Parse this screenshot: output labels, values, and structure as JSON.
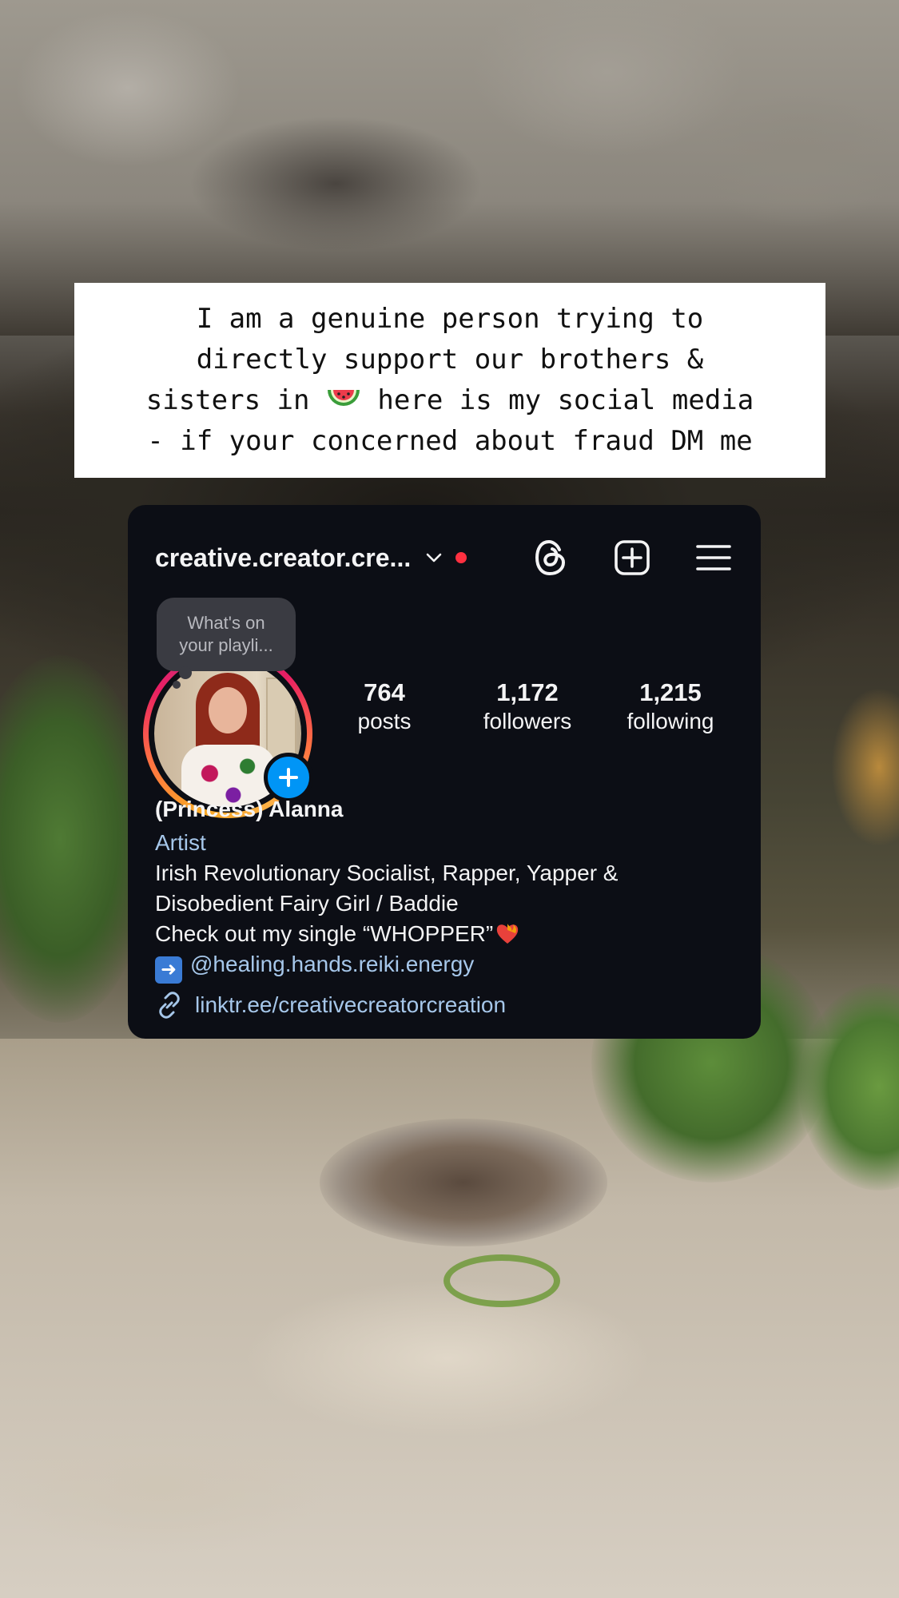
{
  "caption": {
    "line1": "I am a genuine person trying to",
    "line2": "directly support our brothers &",
    "line3_a": "sisters in ",
    "line3_b": " here is my social media",
    "line4": "- if your concerned about fraud DM me",
    "emoji": "watermelon-emoji"
  },
  "profile": {
    "username": "creative.creator.cre...",
    "note": "What's on your playli...",
    "stats": {
      "posts_count": "764",
      "posts_label": "posts",
      "followers_count": "1,172",
      "followers_label": "followers",
      "following_count": "1,215",
      "following_label": "following"
    },
    "bio": {
      "name": "(Princess) Alanna",
      "category": "Artist",
      "line1": "Irish Revolutionary Socialist, Rapper, Yapper &",
      "line2": "Disobedient Fairy Girl / Baddie",
      "line3": "Check out my single “WHOPPER”",
      "mention": "@healing.hands.reiki.energy",
      "link": "linktr.ee/creativecreatorcreation"
    }
  },
  "icons": {
    "chevron": "chevron-down-icon",
    "threads": "threads-icon",
    "create": "create-plus-square-icon",
    "menu": "hamburger-menu-icon",
    "add_story": "plus-icon",
    "arrow": "right-arrow-emoji",
    "heart": "heart-on-fire-emoji",
    "link": "link-icon"
  },
  "colors": {
    "card_bg": "#0c0e15",
    "link_blue": "#a6c7ea",
    "notification_red": "#ff3040",
    "add_button_blue": "#0095f6"
  }
}
